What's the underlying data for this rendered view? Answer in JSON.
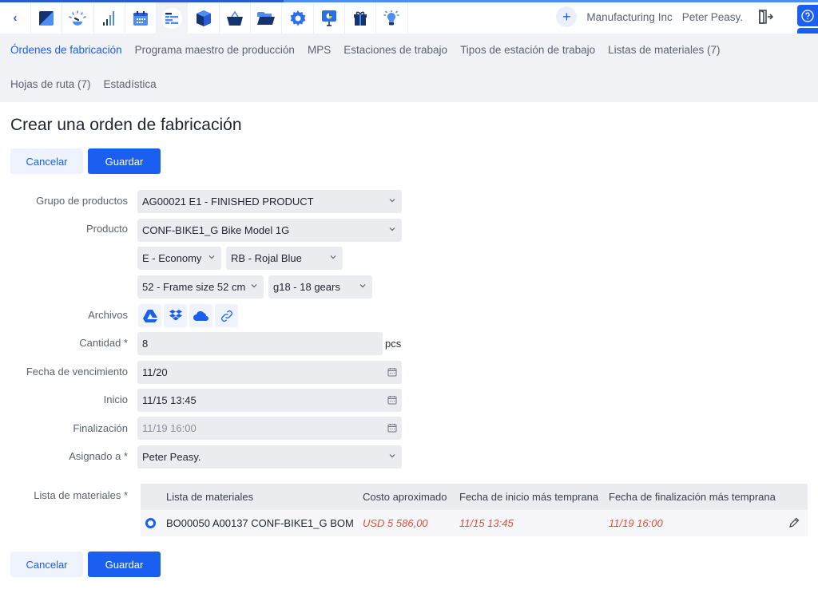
{
  "topbar": {
    "app_icons": [
      {
        "name": "back-chevron-icon",
        "glyph": "‹"
      },
      {
        "name": "dashboard-app-icon"
      },
      {
        "name": "crm-gauge-icon"
      },
      {
        "name": "reports-bars-icon"
      },
      {
        "name": "calendar-icon"
      },
      {
        "name": "manufacturing-gantt-icon",
        "active": true
      },
      {
        "name": "inventory-box-icon"
      },
      {
        "name": "purchasing-basket-icon"
      },
      {
        "name": "files-folder-icon"
      },
      {
        "name": "settings-gear-icon"
      },
      {
        "name": "presentation-icon"
      },
      {
        "name": "gift-icon"
      },
      {
        "name": "idea-bulb-icon"
      }
    ],
    "add_label": "+",
    "company": "Manufacturing Inc",
    "user": "Peter Peasy.",
    "colors": {
      "accent": "#1a5ff0",
      "topline_dark": "#2a5bd7",
      "topline_light": "#4c8df6"
    }
  },
  "subnav": {
    "row1": [
      {
        "label": "Órdenes de fabricación",
        "active": true
      },
      {
        "label": "Programa maestro de producción"
      },
      {
        "label": "MPS"
      },
      {
        "label": "Estaciones de trabajo"
      },
      {
        "label": "Tipos de estación de trabajo"
      },
      {
        "label": "Listas de materiales (7)"
      }
    ],
    "row2": [
      {
        "label": "Hojas de ruta (7)"
      },
      {
        "label": "Estadística"
      }
    ]
  },
  "page": {
    "title": "Crear una orden de fabricación",
    "cancel_label": "Cancelar",
    "save_label": "Guardar"
  },
  "form": {
    "product_group": {
      "label": "Grupo de productos",
      "value": "AG00021 E1 - FINISHED PRODUCT"
    },
    "product": {
      "label": "Producto",
      "value": "CONF-BIKE1_G Bike Model 1G"
    },
    "variants": [
      {
        "value": "E - Economy"
      },
      {
        "value": "RB - Rojal Blue"
      },
      {
        "value": "52 - Frame size 52 cm"
      },
      {
        "value": "g18 - 18 gears"
      }
    ],
    "files": {
      "label": "Archivos",
      "icons": [
        "google-drive-icon",
        "dropbox-icon",
        "onedrive-icon",
        "link-icon"
      ]
    },
    "quantity": {
      "label": "Cantidad *",
      "value": "8",
      "unit": "pcs"
    },
    "due_date": {
      "label": "Fecha de vencimiento",
      "value": "11/20"
    },
    "start": {
      "label": "Inicio",
      "value": "11/15 13:45"
    },
    "finish": {
      "label": "Finalización",
      "value": "11/19 16:00"
    },
    "assigned": {
      "label": "Asignado a *",
      "value": "Peter Peasy."
    },
    "bom": {
      "label": "Lista de materiales *",
      "columns": [
        "Lista de materiales",
        "Costo aproximado",
        "Fecha de inicio más temprana",
        "Fecha de finalización más temprana"
      ],
      "rows": [
        {
          "selected": true,
          "name": "BO00050 A00137 CONF-BIKE1_G BOM",
          "cost": "USD 5 586,00",
          "earliest_start": "11/15 13:45",
          "earliest_finish": "11/19 16:00"
        }
      ]
    }
  }
}
